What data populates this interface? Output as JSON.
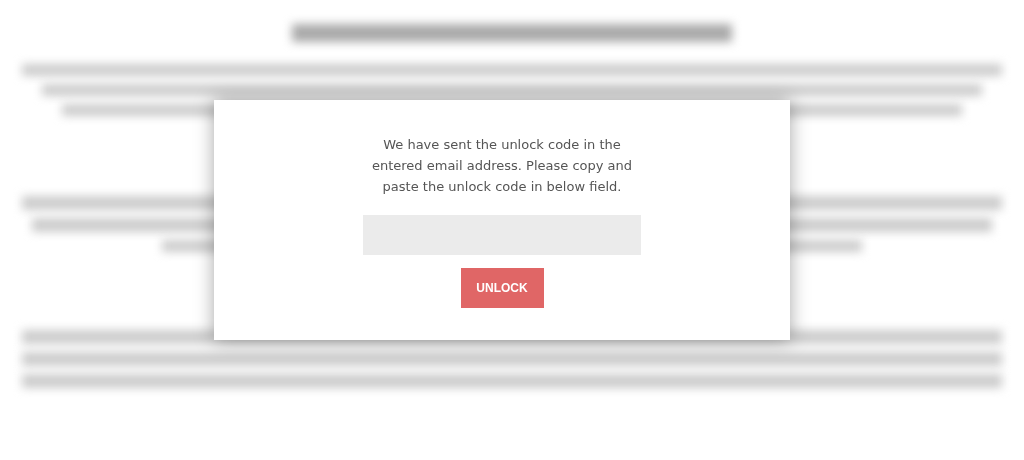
{
  "dialog": {
    "message": "We have sent the unlock code in the entered email address. Please copy and paste the unlock code in below field.",
    "button": {
      "label": "UNLOCK"
    }
  }
}
